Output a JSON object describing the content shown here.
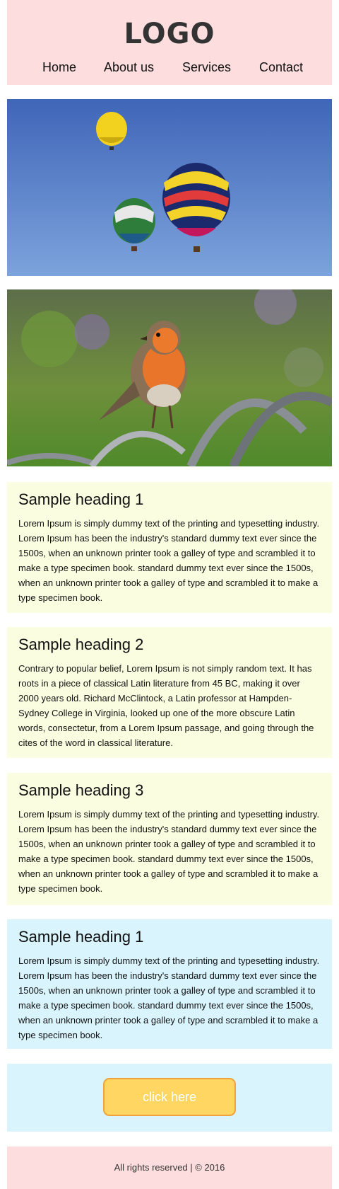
{
  "header": {
    "logo": "LOGO",
    "nav": [
      "Home",
      "About us",
      "Services",
      "Contact"
    ]
  },
  "images": [
    {
      "icon": "hot-air-balloons-photo"
    },
    {
      "icon": "robin-bird-photo"
    }
  ],
  "cards": [
    {
      "heading": "Sample heading 1",
      "text": "Lorem Ipsum is simply dummy text of the printing and typesetting industry. Lorem Ipsum has been the industry's standard dummy text ever since the 1500s, when an unknown printer took a galley of type and scrambled it to make a type specimen book. standard dummy text ever since the 1500s, when an unknown printer took a galley of type and scrambled it to make a type specimen book."
    },
    {
      "heading": "Sample heading 2",
      "text": "Contrary to popular belief, Lorem Ipsum is not simply random text. It has roots in a piece of classical Latin literature from 45 BC, making it over 2000 years old. Richard McClintock, a Latin professor at Hampden-Sydney College in Virginia, looked up one of the more obscure Latin words, consectetur, from a Lorem Ipsum passage, and going through the cites of the word in classical literature."
    },
    {
      "heading": "Sample heading 3",
      "text": "Lorem Ipsum is simply dummy text of the printing and typesetting industry. Lorem Ipsum has been the industry's standard dummy text ever since the 1500s, when an unknown printer took a galley of type and scrambled it to make a type specimen book. standard dummy text ever since the 1500s, when an unknown printer took a galley of type and scrambled it to make a type specimen book."
    },
    {
      "heading": "Sample heading 1",
      "text": "Lorem Ipsum is simply dummy text of the printing and typesetting industry. Lorem Ipsum has been the industry's standard dummy text ever since the 1500s, when an unknown printer took a galley of type and scrambled it to make a type specimen book. standard dummy text ever since the 1500s, when an unknown printer took a galley of type and scrambled it to make a type specimen book."
    }
  ],
  "cta": {
    "label": "click here"
  },
  "footer": {
    "text": "All rights reserved | © 2016"
  },
  "colors": {
    "header_bg": "#fdddde",
    "card_yellow": "#fafde0",
    "card_blue": "#d9f4fd",
    "button_fill": "#fed661",
    "button_border": "#f2a23a"
  }
}
